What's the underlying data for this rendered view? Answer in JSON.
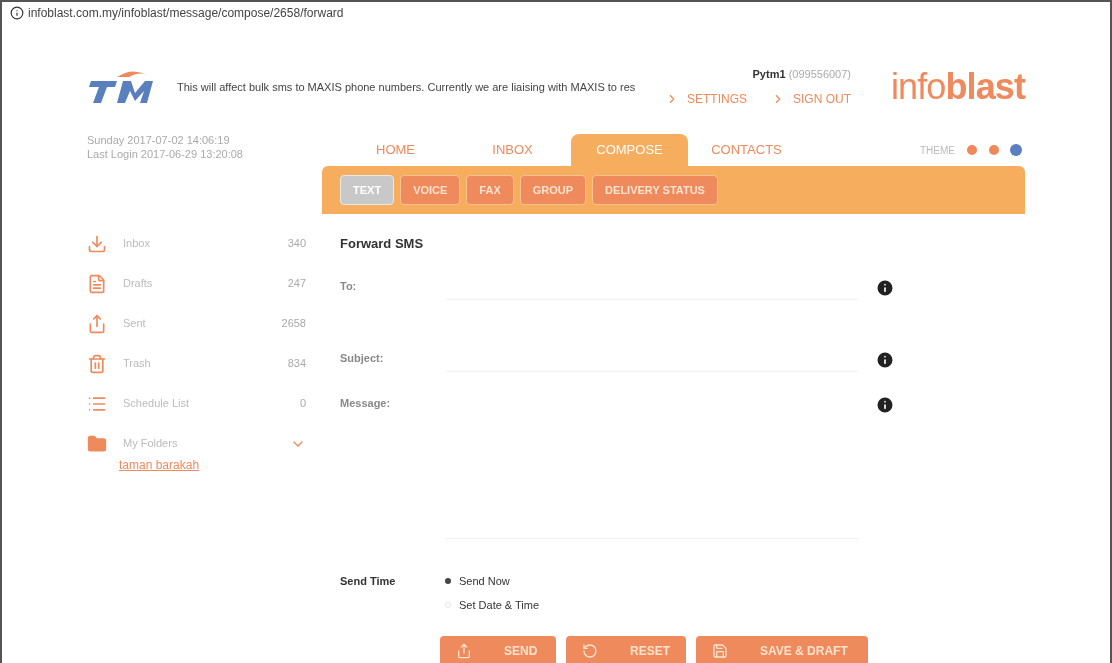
{
  "address_bar": {
    "url": "infoblast.com.my/infoblast/message/compose/2658/forward"
  },
  "header": {
    "notice": "This will affect bulk sms to MAXIS phone numbers. Currently we are liaising with MAXIS to res",
    "user": "Pytm1",
    "user_number": "(099556007)",
    "links": [
      "SETTINGS",
      "SIGN OUT"
    ],
    "brand_light": "info",
    "brand_bold": "blast"
  },
  "session": {
    "date": "Sunday 2017-07-02 14:06:19",
    "last_login": "Last Login 2017-06-29 13:20:08"
  },
  "tabs": [
    {
      "label": "HOME",
      "selected": false
    },
    {
      "label": "INBOX",
      "selected": false
    },
    {
      "label": "COMPOSE",
      "selected": true
    },
    {
      "label": "CONTACTS",
      "selected": false
    }
  ],
  "theme": {
    "label": "THEME",
    "colors": [
      {
        "color": "#f0885a",
        "selected": false
      },
      {
        "color": "#f0885a",
        "selected": false
      },
      {
        "color": "#5b7fc0",
        "selected": true
      }
    ]
  },
  "subtabs": [
    {
      "label": "TEXT",
      "selected": true
    },
    {
      "label": "VOICE",
      "selected": false
    },
    {
      "label": "FAX",
      "selected": false
    },
    {
      "label": "GROUP",
      "selected": false
    },
    {
      "label": "DELIVERY STATUS",
      "selected": false
    }
  ],
  "sidebar": {
    "items": [
      {
        "kind": "inbox",
        "label": "Inbox",
        "count": "340"
      },
      {
        "kind": "drafts",
        "label": "Drafts",
        "count": "247"
      },
      {
        "kind": "sent",
        "label": "Sent",
        "count": "2658"
      },
      {
        "kind": "trash",
        "label": "Trash",
        "count": "834"
      },
      {
        "kind": "schedule",
        "label": "Schedule List",
        "count": "0"
      },
      {
        "kind": "folders",
        "label": "My Folders",
        "expanded": true,
        "children": [
          {
            "label": "taman barakah"
          }
        ]
      }
    ]
  },
  "form": {
    "title": "Forward SMS",
    "fields": [
      {
        "kind": "to",
        "label": "To:"
      },
      {
        "kind": "subject",
        "label": "Subject:"
      },
      {
        "kind": "message",
        "label": "Message:"
      }
    ],
    "send_time": {
      "label": "Send Time",
      "options": [
        {
          "label": "Send Now",
          "selected": true
        },
        {
          "label": "Set Date & Time",
          "selected": false
        }
      ]
    },
    "buttons": [
      {
        "kind": "send",
        "label": "SEND"
      },
      {
        "kind": "reset",
        "label": "RESET"
      },
      {
        "kind": "save",
        "label": "SAVE & DRAFT"
      }
    ]
  }
}
